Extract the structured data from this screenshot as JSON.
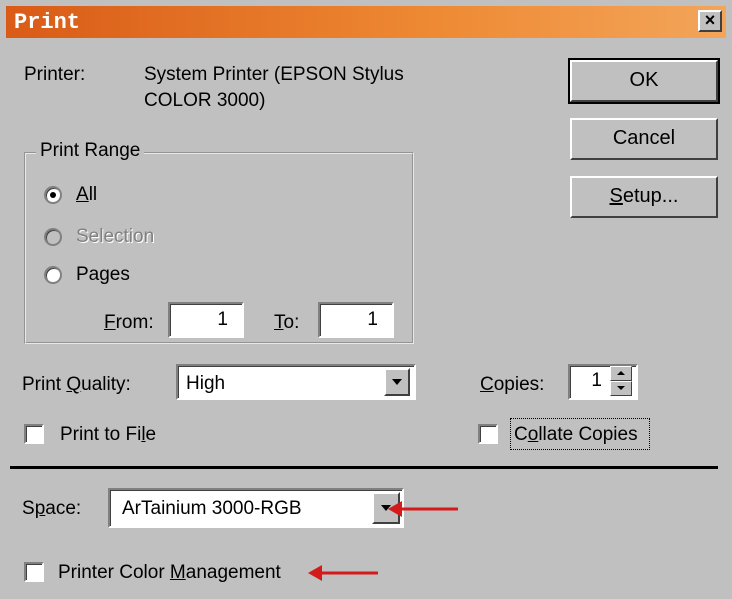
{
  "window": {
    "title": "Print",
    "close_symbol": "×"
  },
  "printer": {
    "label": "Printer:",
    "value_line1": "System Printer (EPSON Stylus",
    "value_line2": "COLOR 3000)"
  },
  "buttons": {
    "ok": "OK",
    "cancel": "Cancel",
    "setup": "Setup..."
  },
  "print_range": {
    "legend": "Print Range",
    "options": [
      {
        "label": "All",
        "selected": true,
        "enabled": true
      },
      {
        "label": "Selection",
        "selected": false,
        "enabled": false
      },
      {
        "label": "Pages",
        "selected": false,
        "enabled": true
      }
    ],
    "from_label": "From:",
    "from_value": "1",
    "to_label": "To:",
    "to_value": "1"
  },
  "quality": {
    "label": "Print Quality:",
    "value": "High"
  },
  "copies": {
    "label": "Copies:",
    "value": "1"
  },
  "print_to_file": {
    "label": "Print to File",
    "checked": false
  },
  "collate": {
    "label": "Collate Copies",
    "checked": false
  },
  "space": {
    "label": "Space:",
    "value": "ArTainium 3000-RGB"
  },
  "color_management": {
    "label": "Printer Color Management",
    "checked": false
  },
  "annotation_color": "#d41a1a"
}
